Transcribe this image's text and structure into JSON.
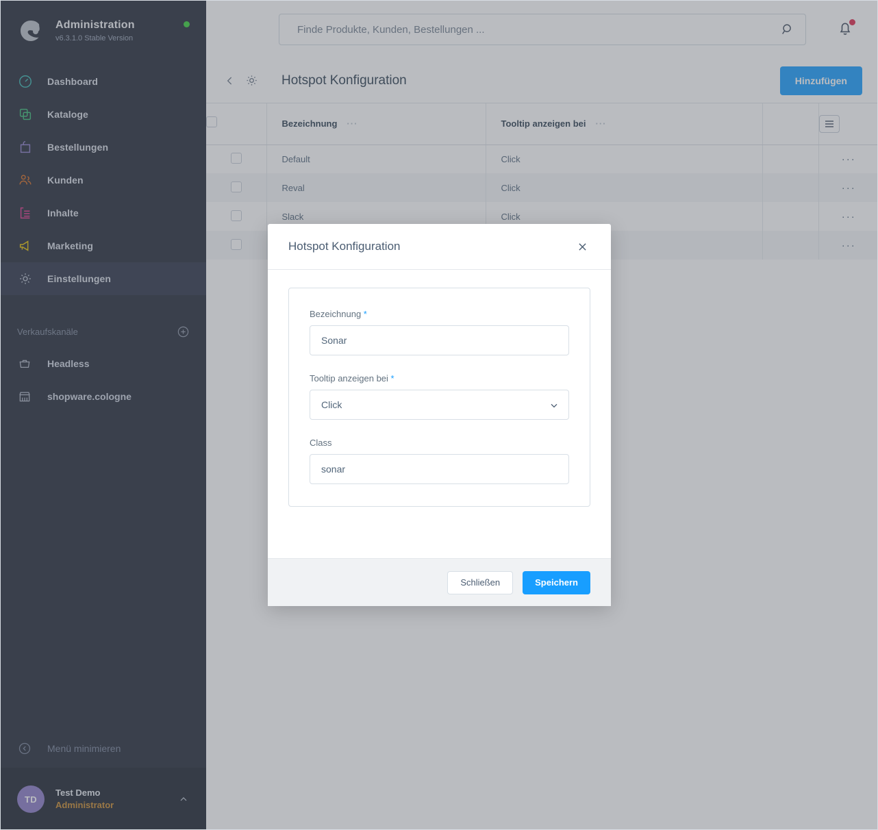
{
  "sidebar": {
    "brand": {
      "title": "Administration",
      "version": "v6.3.1.0 Stable Version",
      "logo_icon": "shopware-logo-icon",
      "status_icon": "status-online-dot"
    },
    "nav_items": [
      {
        "label": "Dashboard",
        "icon": "dashboard-icon",
        "color": "#36b5b0",
        "active": false
      },
      {
        "label": "Kataloge",
        "icon": "catalog-icon",
        "color": "#37b874",
        "active": false
      },
      {
        "label": "Bestellungen",
        "icon": "orders-bag-icon",
        "color": "#8b7bc7",
        "active": false
      },
      {
        "label": "Kunden",
        "icon": "customers-icon",
        "color": "#d2691e",
        "active": false
      },
      {
        "label": "Inhalte",
        "icon": "content-icon",
        "color": "#e0348b",
        "active": false
      },
      {
        "label": "Marketing",
        "icon": "marketing-megaphone-icon",
        "color": "#e5c000",
        "active": false
      },
      {
        "label": "Einstellungen",
        "icon": "settings-gear-icon",
        "color": "#aeb6c4",
        "active": true
      }
    ],
    "sales_channels": {
      "section_title": "Verkaufskanäle",
      "add_icon": "plus-circle-icon",
      "items": [
        {
          "label": "Headless",
          "icon": "basket-icon"
        },
        {
          "label": "shopware.cologne",
          "icon": "storefront-icon"
        }
      ]
    },
    "minimize": {
      "label": "Menü minimieren",
      "icon": "chevron-left-circle-icon"
    },
    "user": {
      "initials": "TD",
      "name": "Test Demo",
      "role": "Administrator",
      "caret_icon": "chevron-up-icon"
    }
  },
  "topbar": {
    "search": {
      "placeholder": "Finde Produkte, Kunden, Bestellungen ...",
      "value": "",
      "icon": "search-icon"
    },
    "notifications": {
      "icon": "bell-icon",
      "has_unread": true,
      "dot_color": "#de294c"
    }
  },
  "pagehead": {
    "back_icon": "chevron-left-icon",
    "gear_icon": "gear-icon",
    "title": "Hotspot Konfiguration",
    "add_button": "Hinzufügen"
  },
  "table": {
    "columns": [
      {
        "label": "Bezeichnung",
        "dots": "···"
      },
      {
        "label": "Tooltip anzeigen bei",
        "dots": "···"
      }
    ],
    "settings_icon": "table-settings-burger-icon",
    "row_action_icon": "row-context-menu-dots",
    "row_action_label": "···",
    "rows": [
      {
        "name": "Default",
        "tooltip_on": "Click"
      },
      {
        "name": "Reval",
        "tooltip_on": "Click"
      },
      {
        "name": "Slack",
        "tooltip_on": "Click"
      },
      {
        "name": "",
        "tooltip_on": ""
      }
    ]
  },
  "modal": {
    "title": "Hotspot Konfiguration",
    "close_icon": "close-x-icon",
    "fields": {
      "bezeichnung": {
        "label": "Bezeichnung",
        "required": true,
        "required_mark": "*",
        "value": "Sonar",
        "placeholder": ""
      },
      "tooltip_on": {
        "label": "Tooltip anzeigen bei",
        "required": true,
        "required_mark": "*",
        "value": "Click",
        "options": [
          "Click"
        ],
        "caret_icon": "chevron-down-icon"
      },
      "css_class": {
        "label": "Class",
        "required": false,
        "value": "sonar",
        "placeholder": ""
      }
    },
    "footer": {
      "close_button": "Schließen",
      "save_button": "Speichern"
    }
  },
  "colors": {
    "sidebar_bg": "#232a38",
    "sidebar_active": "#2b3347",
    "accent_blue": "#189eff",
    "primary_button": "#189eff",
    "status_green": "#37d039",
    "notification_red": "#de294c",
    "role_orange": "#c98b2e",
    "avatar_purple": "#8b7bc7"
  }
}
